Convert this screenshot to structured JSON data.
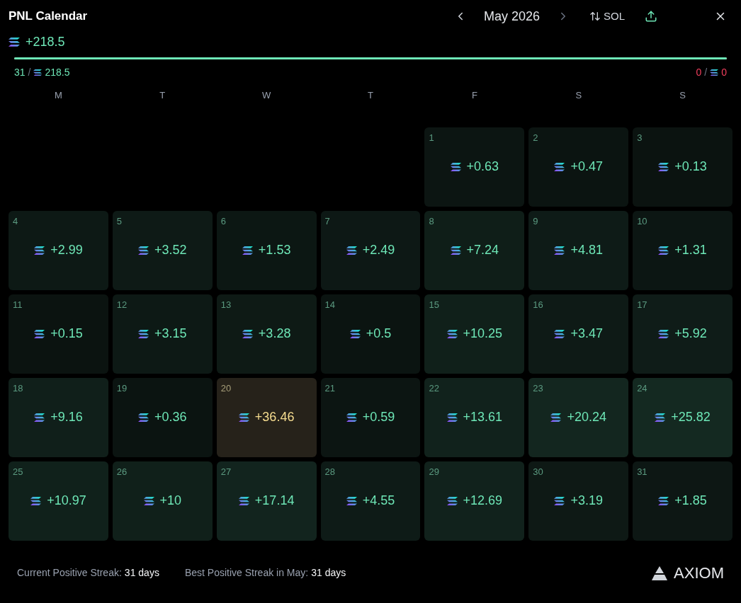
{
  "header": {
    "title": "PNL Calendar",
    "month": "May 2026",
    "currency": "SOL"
  },
  "summary": {
    "total": "+218.5",
    "level": 1,
    "positive_days": "31",
    "positive_total": "218.5",
    "negative_days": "0",
    "negative_total": "0",
    "separator": "/"
  },
  "weekdays": [
    "M",
    "T",
    "W",
    "T",
    "F",
    "S",
    "S"
  ],
  "cells": [
    {
      "kind": "empty"
    },
    {
      "kind": "empty"
    },
    {
      "kind": "empty"
    },
    {
      "kind": "empty"
    },
    {
      "kind": "day",
      "day": "1",
      "value": "+0.63",
      "best": false
    },
    {
      "kind": "day",
      "day": "2",
      "value": "+0.47",
      "best": false
    },
    {
      "kind": "day",
      "day": "3",
      "value": "+0.13",
      "best": false
    },
    {
      "kind": "day",
      "day": "4",
      "value": "+2.99",
      "best": false
    },
    {
      "kind": "day",
      "day": "5",
      "value": "+3.52",
      "best": false
    },
    {
      "kind": "day",
      "day": "6",
      "value": "+1.53",
      "best": false
    },
    {
      "kind": "day",
      "day": "7",
      "value": "+2.49",
      "best": false
    },
    {
      "kind": "day",
      "day": "8",
      "value": "+7.24",
      "best": false
    },
    {
      "kind": "day",
      "day": "9",
      "value": "+4.81",
      "best": false
    },
    {
      "kind": "day",
      "day": "10",
      "value": "+1.31",
      "best": false
    },
    {
      "kind": "day",
      "day": "11",
      "value": "+0.15",
      "best": false
    },
    {
      "kind": "day",
      "day": "12",
      "value": "+3.15",
      "best": false
    },
    {
      "kind": "day",
      "day": "13",
      "value": "+3.28",
      "best": false
    },
    {
      "kind": "day",
      "day": "14",
      "value": "+0.5",
      "best": false
    },
    {
      "kind": "day",
      "day": "15",
      "value": "+10.25",
      "best": false
    },
    {
      "kind": "day",
      "day": "16",
      "value": "+3.47",
      "best": false
    },
    {
      "kind": "day",
      "day": "17",
      "value": "+5.92",
      "best": false
    },
    {
      "kind": "day",
      "day": "18",
      "value": "+9.16",
      "best": false
    },
    {
      "kind": "day",
      "day": "19",
      "value": "+0.36",
      "best": false
    },
    {
      "kind": "day",
      "day": "20",
      "value": "+36.46",
      "best": true
    },
    {
      "kind": "day",
      "day": "21",
      "value": "+0.59",
      "best": false
    },
    {
      "kind": "day",
      "day": "22",
      "value": "+13.61",
      "best": false
    },
    {
      "kind": "day",
      "day": "23",
      "value": "+20.24",
      "best": false
    },
    {
      "kind": "day",
      "day": "24",
      "value": "+25.82",
      "best": false
    },
    {
      "kind": "day",
      "day": "25",
      "value": "+10.97",
      "best": false
    },
    {
      "kind": "day",
      "day": "26",
      "value": "+10",
      "best": false
    },
    {
      "kind": "day",
      "day": "27",
      "value": "+17.14",
      "best": false
    },
    {
      "kind": "day",
      "day": "28",
      "value": "+4.55",
      "best": false
    },
    {
      "kind": "day",
      "day": "29",
      "value": "+12.69",
      "best": false
    },
    {
      "kind": "day",
      "day": "30",
      "value": "+3.19",
      "best": false
    },
    {
      "kind": "day",
      "day": "31",
      "value": "+1.85",
      "best": false
    }
  ],
  "footer": {
    "streaks": [
      {
        "label": "Current Positive Streak:",
        "value": "31 days"
      },
      {
        "label": "Best Positive Streak in May:",
        "value": "31 days"
      }
    ],
    "brand": "AXIOM"
  }
}
